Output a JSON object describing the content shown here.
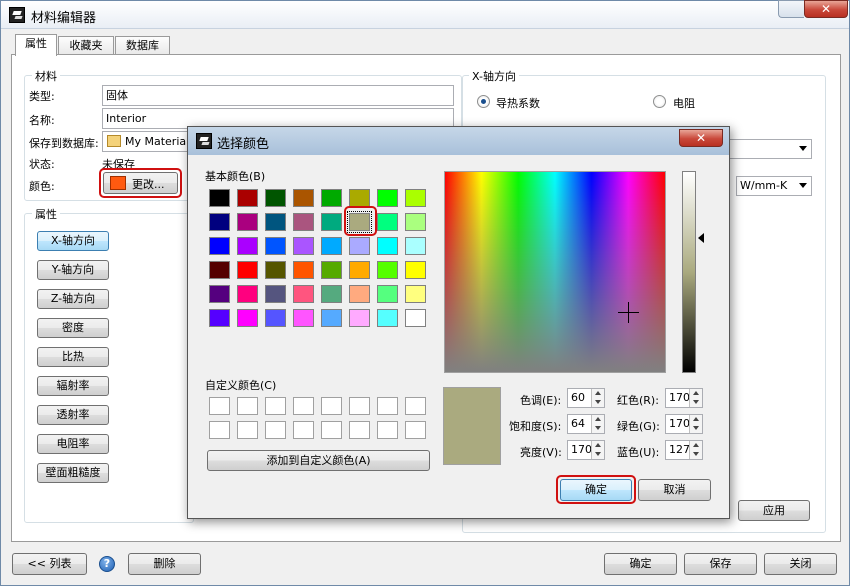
{
  "window": {
    "title": "材料编辑器"
  },
  "tabs": [
    {
      "label": "属性"
    },
    {
      "label": "收藏夹"
    },
    {
      "label": "数据库"
    }
  ],
  "material": {
    "group_title": "材料",
    "type_label": "类型:",
    "type_value": "固体",
    "name_label": "名称:",
    "name_value": "Interior",
    "save_label": "保存到数据库:",
    "save_value": "My Materials",
    "status_label": "状态:",
    "status_value": "未保存",
    "color_label": "颜色:",
    "color_button": "更改...",
    "color_swatch": "#ff5a10"
  },
  "properties": {
    "group_title": "属性",
    "buttons": [
      "X-轴方向",
      "Y-轴方向",
      "Z-轴方向",
      "密度",
      "比热",
      "辐射率",
      "透射率",
      "电阻率",
      "壁面粗糙度"
    ]
  },
  "x_direction": {
    "group_title": "X-轴方向",
    "radio_conductivity": "导热系数",
    "radio_resistance": "电阻",
    "unit": "W/mm-K"
  },
  "buttons": {
    "apply": "应用",
    "list": "<< 列表",
    "delete": "删除",
    "ok": "确定",
    "save": "保存",
    "close": "关闭"
  },
  "dialog": {
    "title": "选择颜色",
    "basic_colors_label": "基本颜色(B)",
    "custom_colors_label": "自定义颜色(C)",
    "add_custom_button": "添加到自定义颜色(A)",
    "basic_colors": [
      [
        "#000000",
        "#aa0000",
        "#005500",
        "#aa5500",
        "#00aa00",
        "#aaaa00",
        "#00ff00",
        "#aaff00"
      ],
      [
        "#00007f",
        "#aa007f",
        "#00557f",
        "#aa557f",
        "#00aa7f",
        "#aaaa7f",
        "#00ff7f",
        "#aaff7f"
      ],
      [
        "#0000ff",
        "#aa00ff",
        "#0055ff",
        "#aa55ff",
        "#00aaff",
        "#aaaaff",
        "#00ffff",
        "#aaffff"
      ],
      [
        "#550000",
        "#ff0000",
        "#555500",
        "#ff5500",
        "#55aa00",
        "#ffaa00",
        "#55ff00",
        "#ffff00"
      ],
      [
        "#55007f",
        "#ff007f",
        "#55557f",
        "#ff557f",
        "#55aa7f",
        "#ffaa7f",
        "#55ff7f",
        "#ffff7f"
      ],
      [
        "#5500ff",
        "#ff00ff",
        "#5555ff",
        "#ff55ff",
        "#55aaff",
        "#ffaaff",
        "#55ffff",
        "#ffffff"
      ]
    ],
    "selected_color": "#aaaa7f",
    "hue_label": "色调(E):",
    "hue": "60",
    "sat_label": "饱和度(S):",
    "sat": "64",
    "lum_label": "亮度(V):",
    "lum": "170",
    "red_label": "红色(R):",
    "red": "170",
    "green_label": "绿色(G):",
    "green": "170",
    "blue_label": "蓝色(U):",
    "blue": "127",
    "ok_button": "确定",
    "cancel_button": "取消"
  }
}
